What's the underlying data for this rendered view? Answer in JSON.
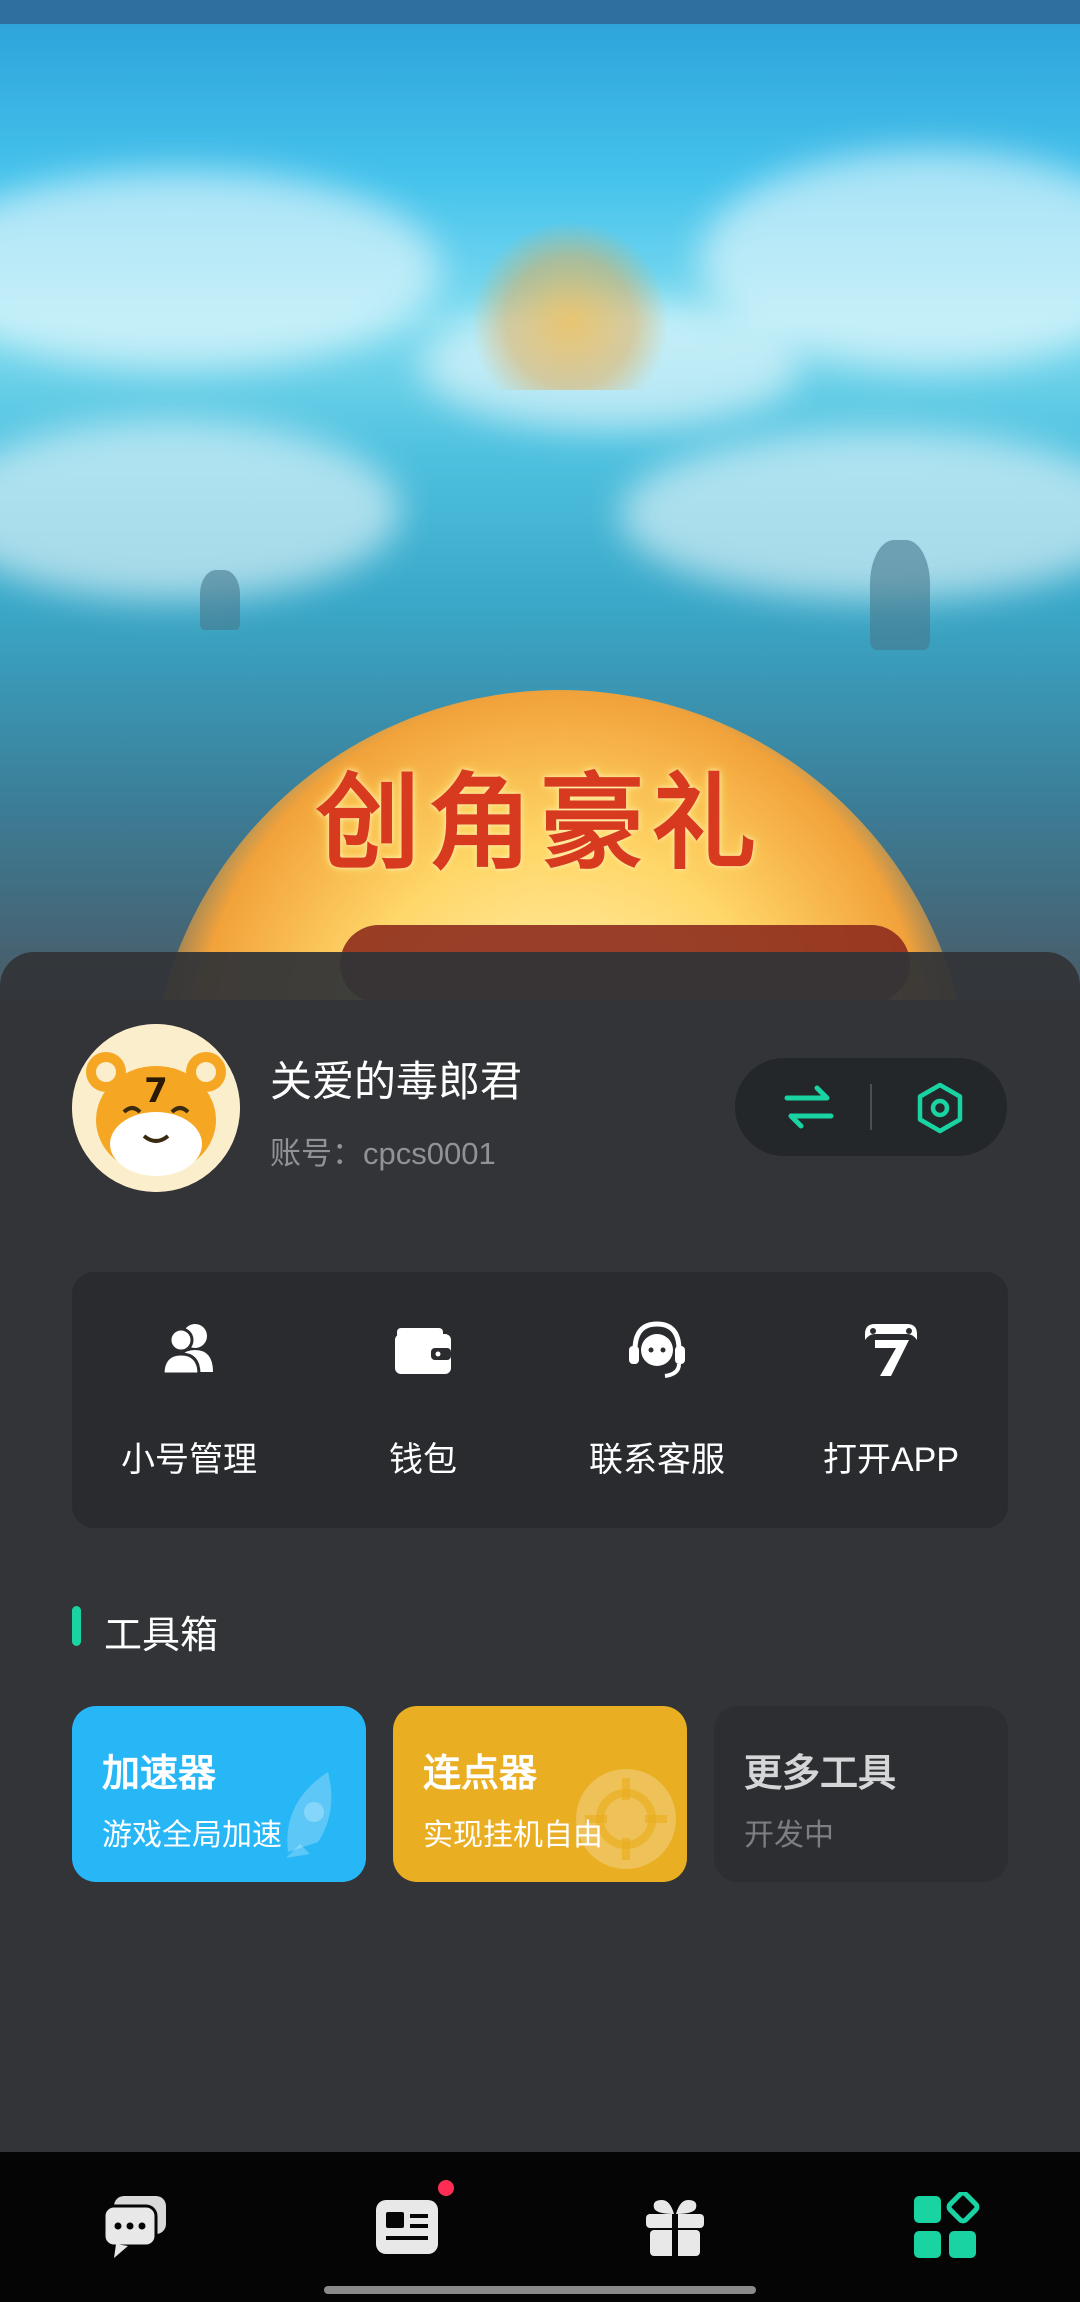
{
  "banner": {
    "title": "创角豪礼"
  },
  "profile": {
    "name": "关爱的毒郎君",
    "account_label": "账号：cpcs0001",
    "avatar_text": "7"
  },
  "header_actions": {
    "switch_icon": "swap-arrows-icon",
    "settings_icon": "hexagon-settings-icon",
    "accent_color": "#19d3a2"
  },
  "quick_actions": [
    {
      "label": "小号管理",
      "icon": "users-icon"
    },
    {
      "label": "钱包",
      "icon": "wallet-icon"
    },
    {
      "label": "联系客服",
      "icon": "headset-icon"
    },
    {
      "label": "打开APP",
      "icon": "app-7-icon"
    }
  ],
  "toolbox": {
    "title": "工具箱",
    "tools": [
      {
        "name": "加速器",
        "desc": "游戏全局加速",
        "color": "#27b6f6"
      },
      {
        "name": "连点器",
        "desc": "实现挂机自由",
        "color": "#e9ae21"
      },
      {
        "name": "更多工具",
        "desc": "开发中",
        "color": "#2c2e31"
      }
    ]
  },
  "bottom_nav": [
    {
      "icon": "chat-bubbles-icon"
    },
    {
      "icon": "news-icon",
      "badge": true
    },
    {
      "icon": "gift-icon"
    },
    {
      "icon": "apps-grid-icon",
      "active": true
    }
  ]
}
